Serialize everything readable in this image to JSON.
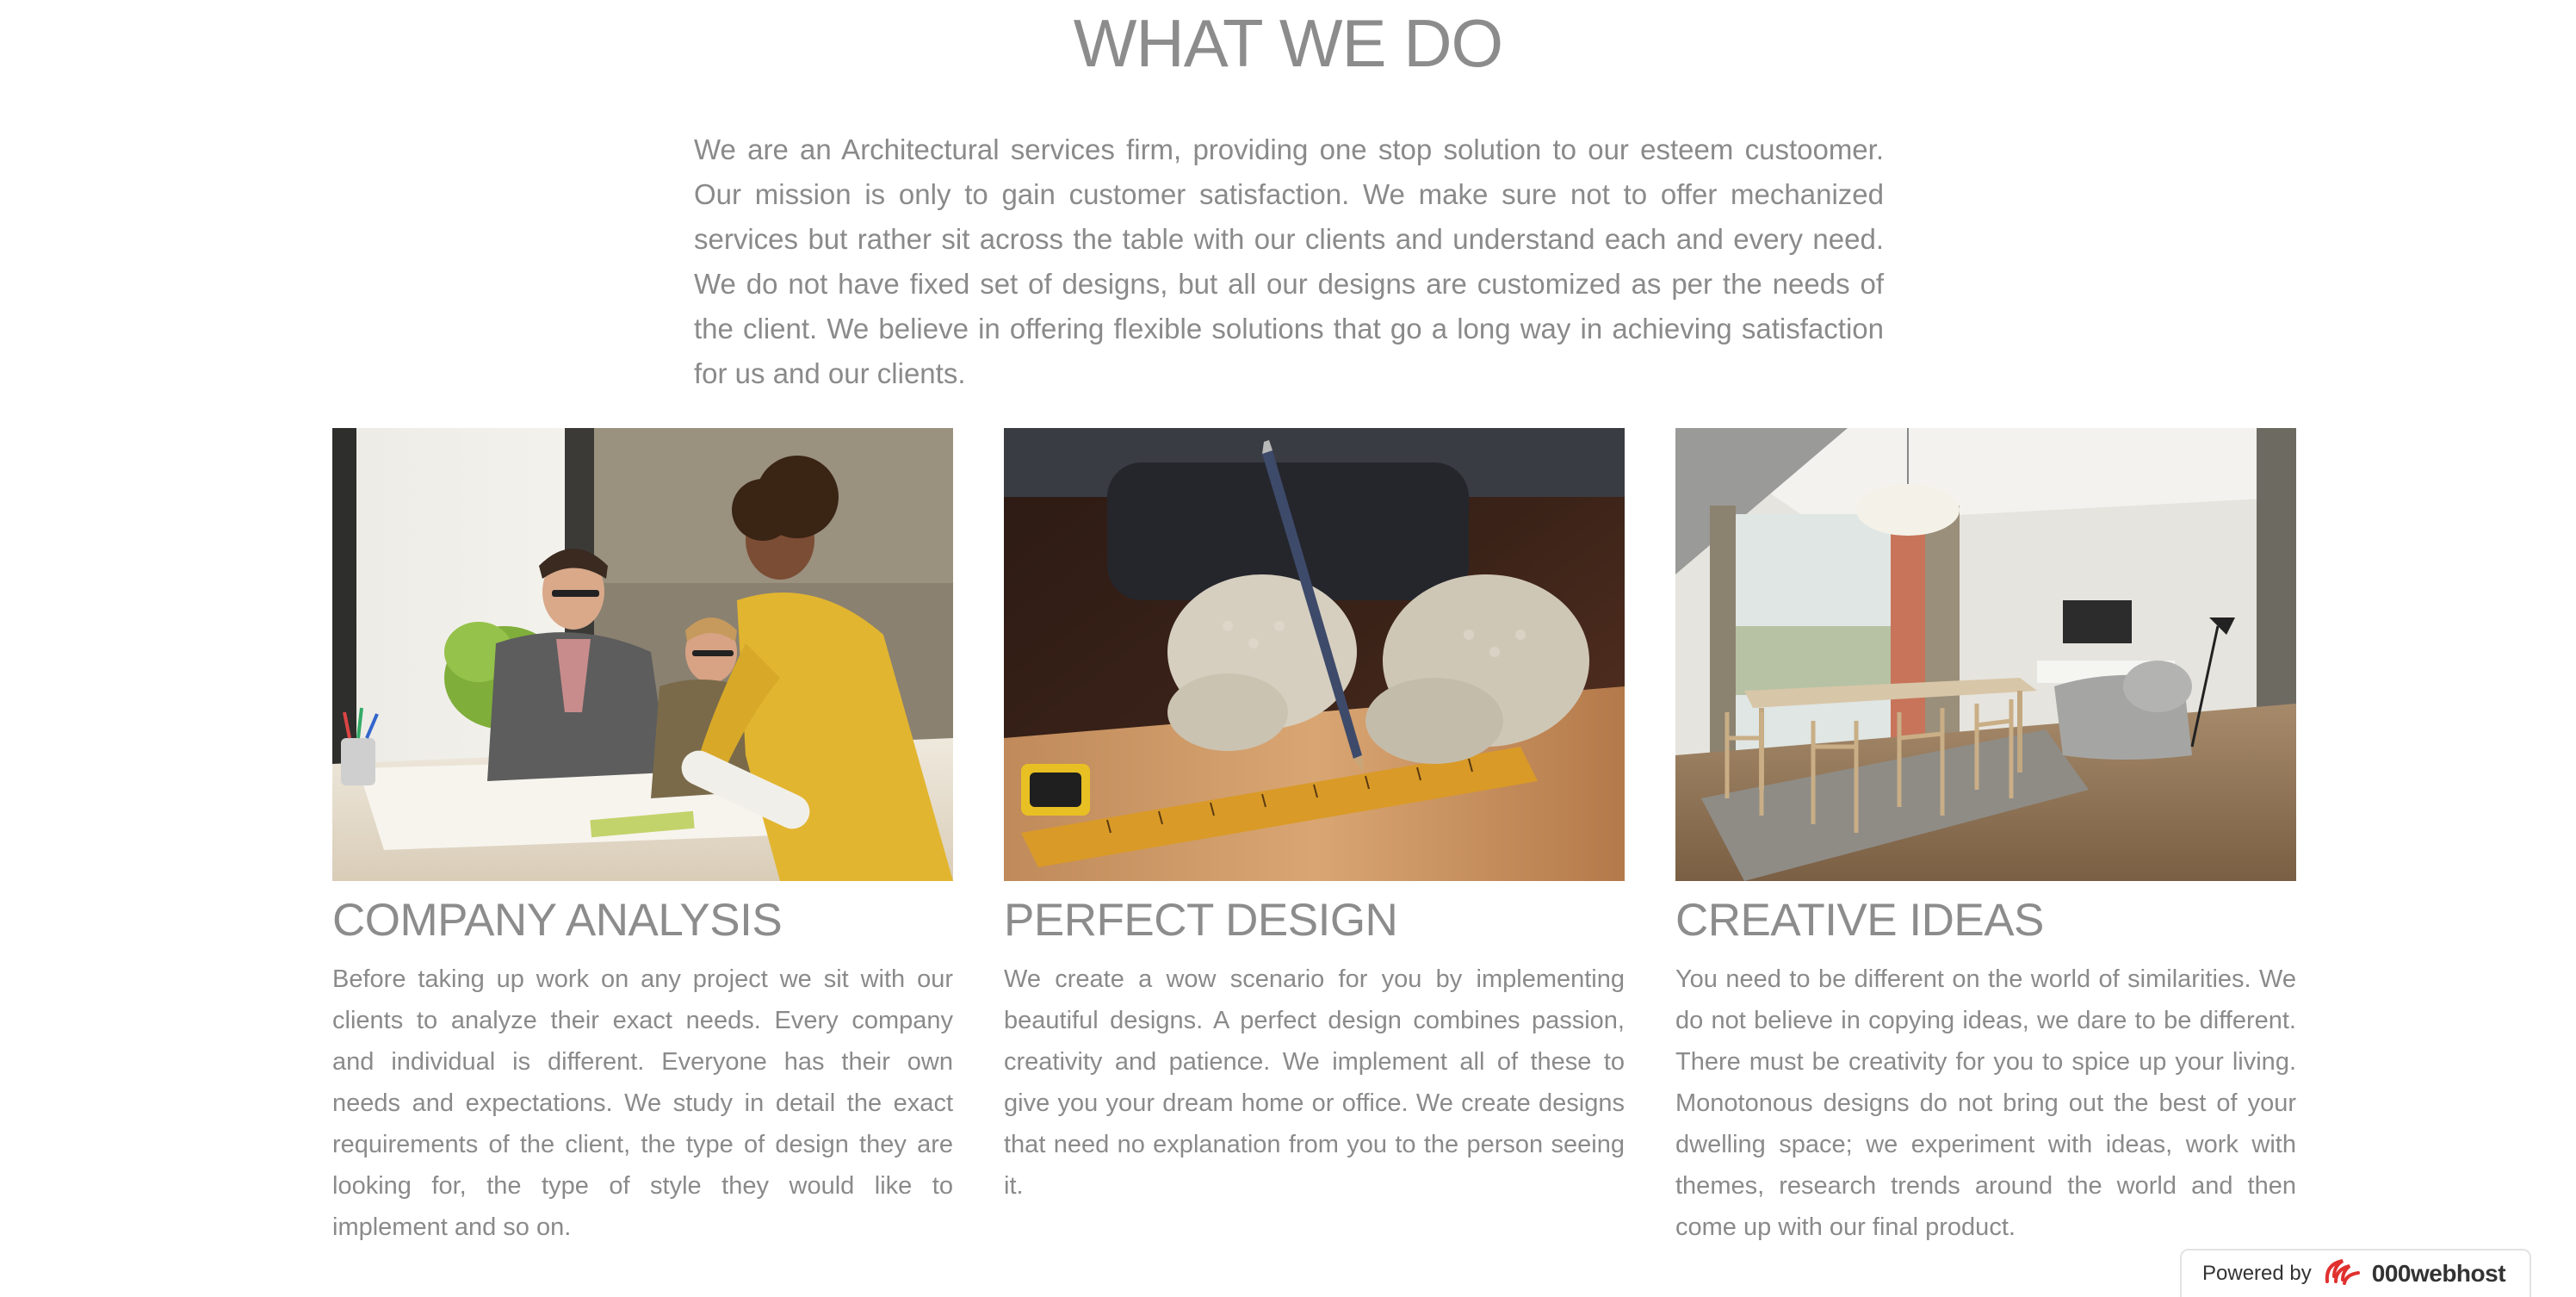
{
  "section": {
    "title": "WHAT WE DO",
    "intro": "We are an Architectural services firm, providing one stop solution to our esteem custoomer. Our mission is only to gain customer satisfaction. We make sure not to offer mechanized services but rather sit across the table with our clients and understand each and every need. We do not have fixed set of designs, but all our designs are customized as per the needs of the client. We believe in offering flexible solutions that go a long way in achieving satisfaction for us and our clients."
  },
  "columns": [
    {
      "title": "COMPANY ANALYSIS",
      "text": "Before taking up work on any project we sit with our clients to analyze their exact needs. Every company and individual is different. Everyone has their own needs and expectations. We study in detail the exact requirements of the client, the type of design they are looking for, the type of style they would like to implement and so on.",
      "image": "team-reviewing-blueprints-photo"
    },
    {
      "title": "PERFECT DESIGN",
      "text": "We create a wow scenario for you by implementing beautiful designs. A perfect design combines passion, creativity and patience. We implement all of these to give you your dream home or office. We create designs that need no explanation from you to the person seeing it.",
      "image": "gloved-hands-pencil-ruler-photo"
    },
    {
      "title": "CREATIVE IDEAS",
      "text": "You need to be different on the world of similarities. We do not believe in copying ideas, we dare to be different. There must be creativity for you to spice up your living. Monotonous designs do not bring out the best of your dwelling space; we experiment with ideas, work with themes, research trends around the world and then come up with our final product.",
      "image": "modern-dining-living-room-photo"
    }
  ],
  "badge": {
    "label": "Powered by",
    "brand": "000webhost",
    "icon": "000webhost-logo-icon"
  }
}
